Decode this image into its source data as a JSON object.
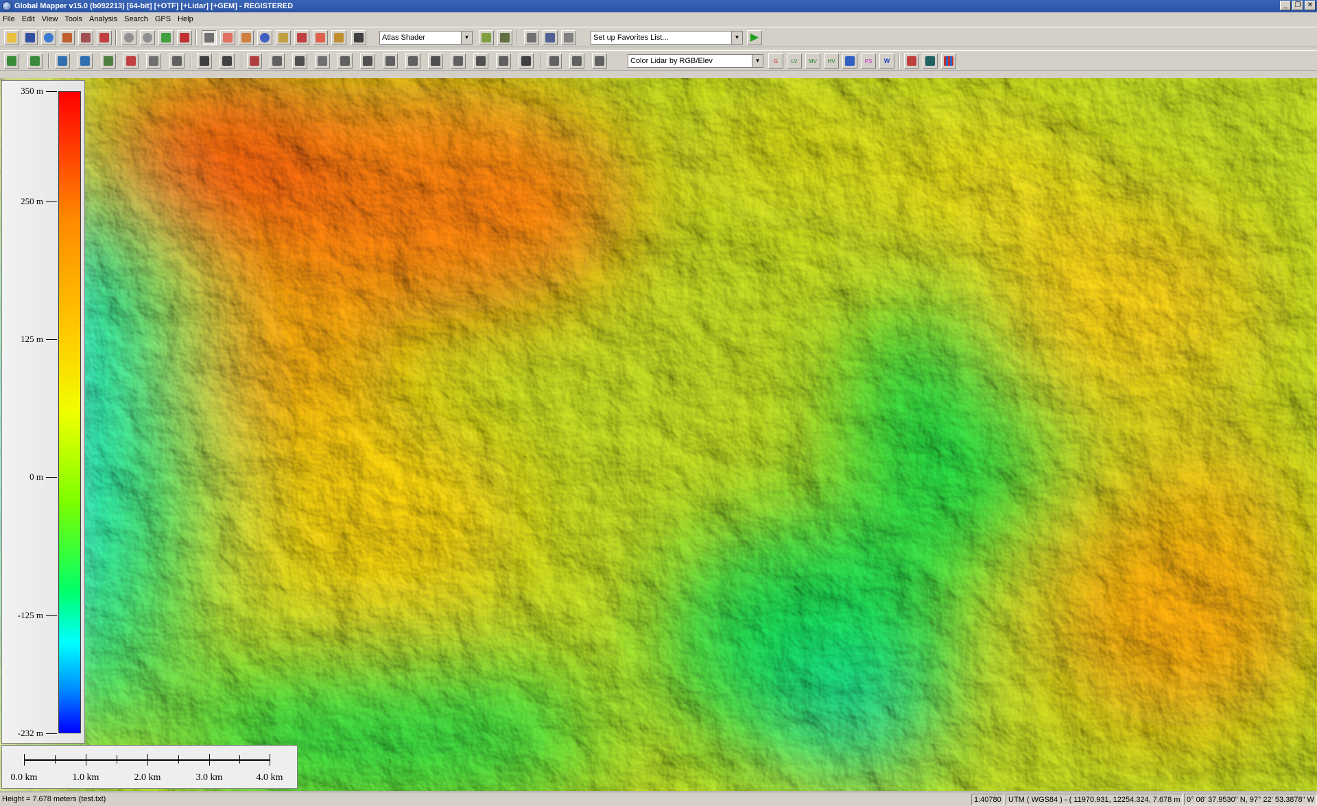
{
  "window": {
    "title": "Global Mapper v15.0 (b092213) [64-bit] [+OTF] [+Lidar] [+GEM] - REGISTERED"
  },
  "menu": [
    "File",
    "Edit",
    "View",
    "Tools",
    "Analysis",
    "Search",
    "GPS",
    "Help"
  ],
  "toolbar1": {
    "shader_select": "Atlas Shader",
    "favorites_select": "Set up Favorites List..."
  },
  "toolbar2": {
    "lidar_color_select": "Color Lidar by RGB/Elev"
  },
  "toolbar2_icons": [
    "G",
    "LV",
    "MV",
    "HV",
    "PS",
    "W"
  ],
  "elevation_legend": {
    "labels": [
      "350 m",
      "250 m",
      "125 m",
      "0 m",
      "-125 m",
      "-232 m"
    ],
    "levels": [
      350,
      250,
      125,
      0,
      -125,
      -232
    ],
    "max": 350,
    "min": -232
  },
  "scale_bar": {
    "labels": [
      "0.0 km",
      "1.0 km",
      "2.0 km",
      "3.0 km",
      "4.0 km"
    ],
    "values_km": [
      0,
      1,
      2,
      3,
      4
    ]
  },
  "status": {
    "height": "Height = 7.678 meters (test.txt)",
    "scale": "1:40780",
    "projection": "UTM ( WGS84 ) - ( 11970.931, 12254.324, 7.678 m )",
    "geo": "0° 06' 37.9530\" N, 97° 22' 53.3878\" W"
  },
  "colors": {
    "title_bar": "#2a54a6",
    "chrome": "#d4d0c8"
  }
}
